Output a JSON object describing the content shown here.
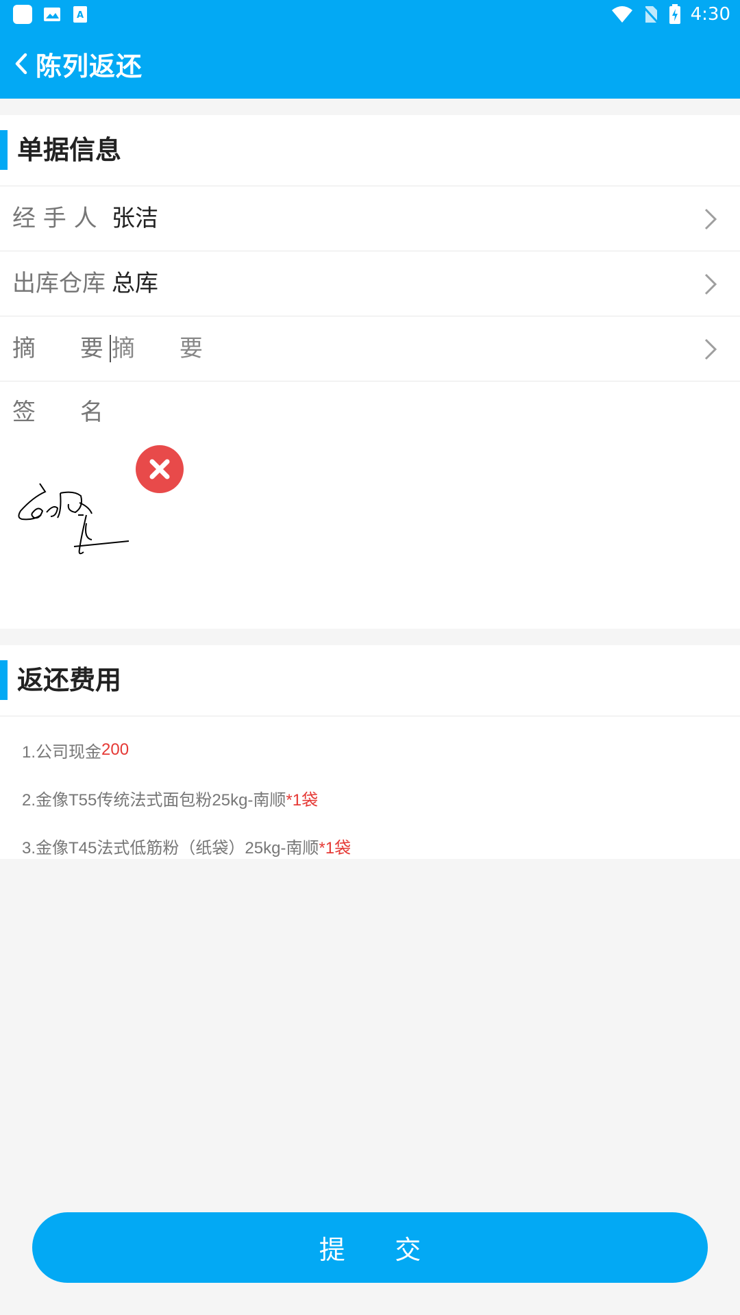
{
  "status_bar": {
    "time": "4:30",
    "left_icons": [
      "app-icon",
      "image-icon",
      "text-icon"
    ],
    "right_icons": [
      "wifi-icon",
      "no-sim-icon",
      "battery-charging-icon"
    ]
  },
  "app_bar": {
    "title": "陈列返还",
    "back_icon": "chevron-left-icon"
  },
  "document_info": {
    "section_title": "单据信息",
    "handler": {
      "label": "经 手 人",
      "value": "张洁"
    },
    "warehouse": {
      "label": "出库仓库",
      "value": "总库"
    },
    "summary": {
      "label": "摘      要",
      "placeholder": "摘      要"
    },
    "signature": {
      "label": "签      名",
      "delete_icon": "close-circle-icon"
    }
  },
  "return_fees": {
    "section_title": "返还费用",
    "items": [
      {
        "text": "1.公司现金",
        "highlight": "200"
      },
      {
        "text": "2.金像T55传统法式面包粉25kg-南顺",
        "highlight": "*1袋"
      },
      {
        "text": "3.金像T45法式低筋粉（纸袋）25kg-南顺",
        "highlight": "*1袋"
      }
    ]
  },
  "submit_button": {
    "label": "提      交"
  },
  "colors": {
    "primary": "#03a9f4",
    "highlight": "#e53935",
    "delete": "#e84a4a",
    "background": "#f5f5f5"
  }
}
